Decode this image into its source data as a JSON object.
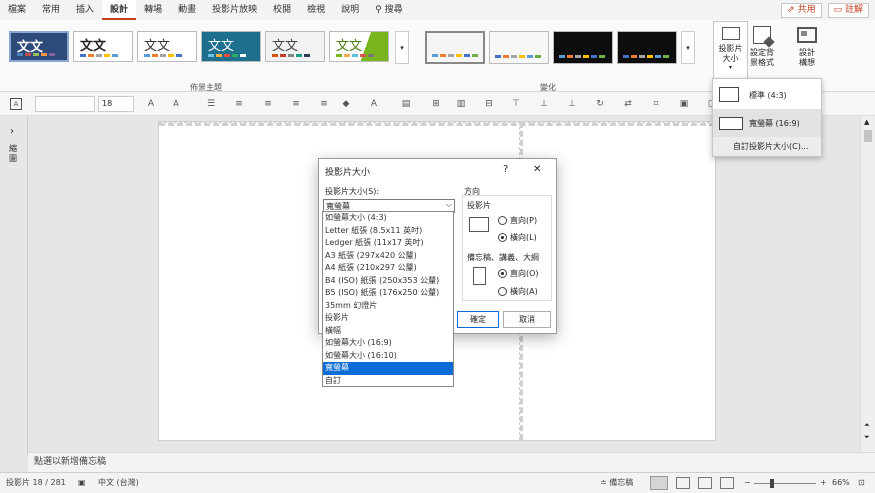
{
  "tabs": [
    "檔案",
    "常用",
    "插入",
    "設計",
    "轉場",
    "動畫",
    "投影片放映",
    "校閱",
    "檢視",
    "說明",
    "搜尋"
  ],
  "active_tab": "設計",
  "top_right": {
    "share": "共用",
    "comments": "註解"
  },
  "ribbon": {
    "theme_glyph": "文文",
    "themes_group": "佈景主題",
    "variants_group": "變化",
    "slide_size_btn": "投影片\n大小",
    "format_bg_btn": "設定背\n景格式",
    "designer_btn": "設計\n構想",
    "colors": {
      "accent": "#c43e1c",
      "t1": "#2e4a7a",
      "t4": "#1e6e8e"
    }
  },
  "format_bar": {
    "font_size": "18"
  },
  "left_pane_label": "縮圖",
  "slide_size_menu": {
    "standard": "標準 (4:3)",
    "widescreen": "寬螢幕 (16:9)",
    "custom": "自訂投影片大小(C)..."
  },
  "dialog": {
    "title": "投影片大小",
    "help": "?",
    "close": "✕",
    "size_label": "投影片大小(S):",
    "size_value": "寬螢幕",
    "orientation": "方向",
    "slides": "投影片",
    "portrait": "直向(P)",
    "landscape": "橫向(L)",
    "notes": "備忘稿、講義、大綱",
    "notes_portrait": "直向(O)",
    "notes_landscape": "橫向(A)",
    "ok": "確定",
    "cancel": "取消",
    "options": [
      "如螢幕大小 (4:3)",
      "Letter 紙張 (8.5x11 英吋)",
      "Ledger 紙張 (11x17 英吋)",
      "A3 紙張 (297x420 公釐)",
      "A4 紙張 (210x297 公釐)",
      "B4 (ISO) 紙張 (250x353 公釐)",
      "B5 (ISO) 紙張 (176x250 公釐)",
      "35mm 幻燈片",
      "投影片",
      "橫幅",
      "如螢幕大小 (16:9)",
      "如螢幕大小 (16:10)",
      "寬螢幕",
      "自訂"
    ],
    "selected_index": 12
  },
  "notes_placeholder": "點選以新增備忘稿",
  "status": {
    "slide_counter": "投影片 18 / 281",
    "language": "中文 (台灣)",
    "notes_btn": "備忘稿",
    "zoom": "66%"
  }
}
